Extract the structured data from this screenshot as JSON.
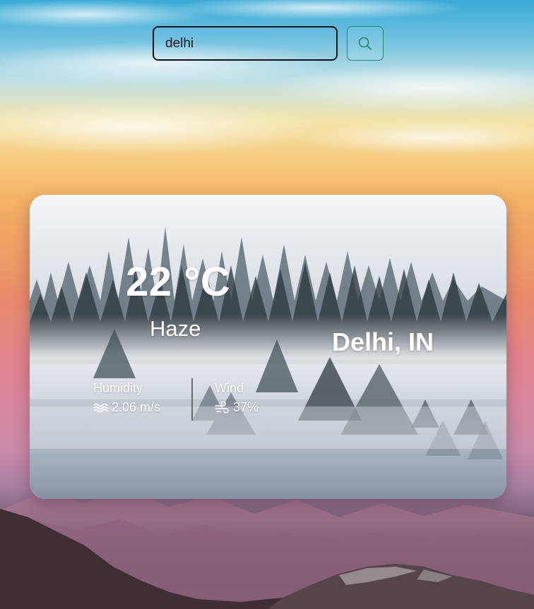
{
  "search": {
    "value": "delhi",
    "button_icon": "search-icon"
  },
  "weather": {
    "temperature": "22 °C",
    "condition": "Haze",
    "location": "Delhi, IN",
    "humidity": {
      "label": "Humidity",
      "value": "2.06 m/s",
      "icon": "water-waves-icon"
    },
    "wind": {
      "label": "Wind",
      "value": "37%",
      "icon": "wind-icon"
    }
  },
  "colors": {
    "search_border": "#111111",
    "search_button_border": "#1f8a5a",
    "text_on_card": "#ffffff"
  }
}
